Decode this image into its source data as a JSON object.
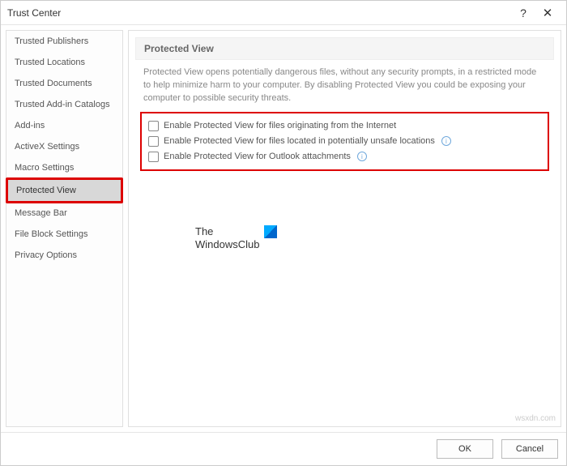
{
  "window": {
    "title": "Trust Center"
  },
  "sidebar": {
    "items": [
      {
        "label": "Trusted Publishers"
      },
      {
        "label": "Trusted Locations"
      },
      {
        "label": "Trusted Documents"
      },
      {
        "label": "Trusted Add-in Catalogs"
      },
      {
        "label": "Add-ins"
      },
      {
        "label": "ActiveX Settings"
      },
      {
        "label": "Macro Settings"
      },
      {
        "label": "Protected View"
      },
      {
        "label": "Message Bar"
      },
      {
        "label": "File Block Settings"
      },
      {
        "label": "Privacy Options"
      }
    ]
  },
  "content": {
    "section_title": "Protected View",
    "description": "Protected View opens potentially dangerous files, without any security prompts, in a restricted mode to help minimize harm to your computer. By disabling Protected View you could be exposing your computer to possible security threats.",
    "options": [
      {
        "label": "Enable Protected View for files originating from the Internet",
        "info": false
      },
      {
        "label": "Enable Protected View for files located in potentially unsafe locations",
        "info": true
      },
      {
        "label": "Enable Protected View for Outlook attachments",
        "info": true
      }
    ]
  },
  "watermark": {
    "line1": "The",
    "line2": "WindowsClub"
  },
  "footer": {
    "ok": "OK",
    "cancel": "Cancel"
  },
  "attribution": "wsxdn.com"
}
